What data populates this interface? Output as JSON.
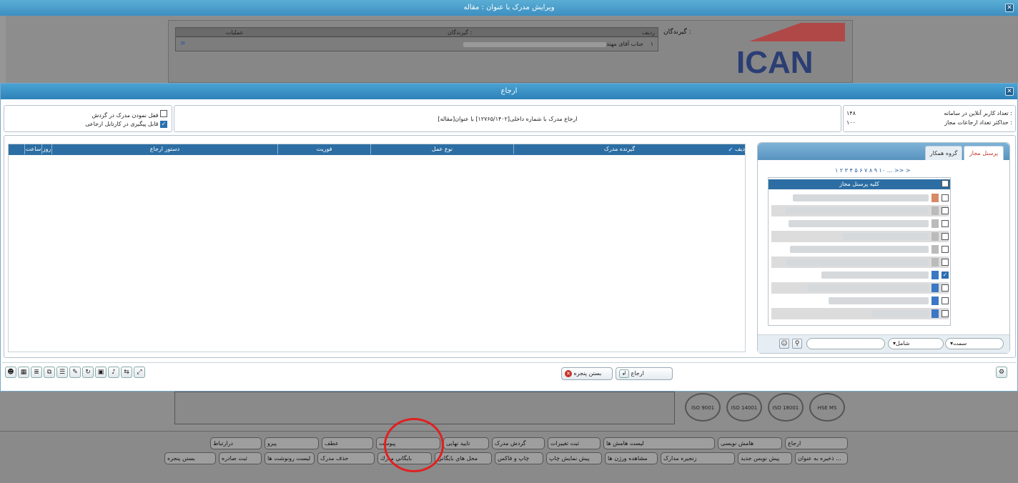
{
  "window": {
    "title": "ویرایش مدرک با عنوان : مقاله",
    "close": "✕"
  },
  "recipients": {
    "label": "گیرندگان :",
    "columns": [
      "ردیف",
      "گیرندگان :",
      "عملیات"
    ],
    "rows": [
      {
        "index": "۱",
        "name": "جناب آقای مهندس"
      }
    ]
  },
  "logo": {
    "text": "ICAN",
    "color": "#1d3f86",
    "accent": "#d9363e"
  },
  "modal": {
    "title": "ارجاع",
    "online_users_label": "تعداد کاربر آنلاین در سامانه :",
    "online_users_value": "۱۴۸",
    "max_referrals_label": "حداکثر تعداد ارجاعات مجاز :",
    "max_referrals_value": "۱۰۰",
    "referral_desc": "ارجاع مدرک با شماره داخلی[۱۲۷۶۵/۱۴۰۲] با عنوان[مقاله]",
    "lock_label": "قفل نمودن مدرک در گردش",
    "track_label": "قابل پیگیری در کارتابل ارجاعی",
    "grid_columns": [
      "ردیف",
      "گیرنده مدرک",
      "نوع عمل",
      "فوریت",
      "دستور ارجاع",
      "روز",
      "ساعت"
    ],
    "tabs": [
      "پرسنل مجاز",
      "گروه همکار"
    ],
    "pager": "۱ ۲ ۳ ۴ ۵ ۶ ۷ ۸ ۹ ۱۰ ... >> >",
    "personnel_header": "کلیه پرسنل مجاز",
    "filter_field": "سمت",
    "filter_op": "شامل",
    "refer_button": "ارجاع",
    "close_button": "بستن پنجره"
  },
  "bottom": {
    "row1": [
      "ارجاع",
      "هامش نویسی",
      "لیست هامش ها",
      "ثبت تغییرات",
      "گردش مدرک",
      "تایید نهایی",
      "پیوست",
      "عطف",
      "پیرو",
      "درارتباط"
    ],
    "row2": [
      "ذخیره به عنوان ...",
      "پیش نویس جدید",
      "زنجیره مدارک",
      "مشاهده ورژن ها",
      "پیش نمایش چاپ",
      "چاپ و فاکس",
      "محل هاي بايگاني",
      "بايگاني مدرك",
      "حذف مدرک",
      "لیست رونوشت ها",
      "ثبت صادره",
      "بستن پنجره"
    ]
  },
  "iso": [
    "ISO 9001",
    "ISO 14001",
    "ISO 18001",
    "HSE MS"
  ]
}
